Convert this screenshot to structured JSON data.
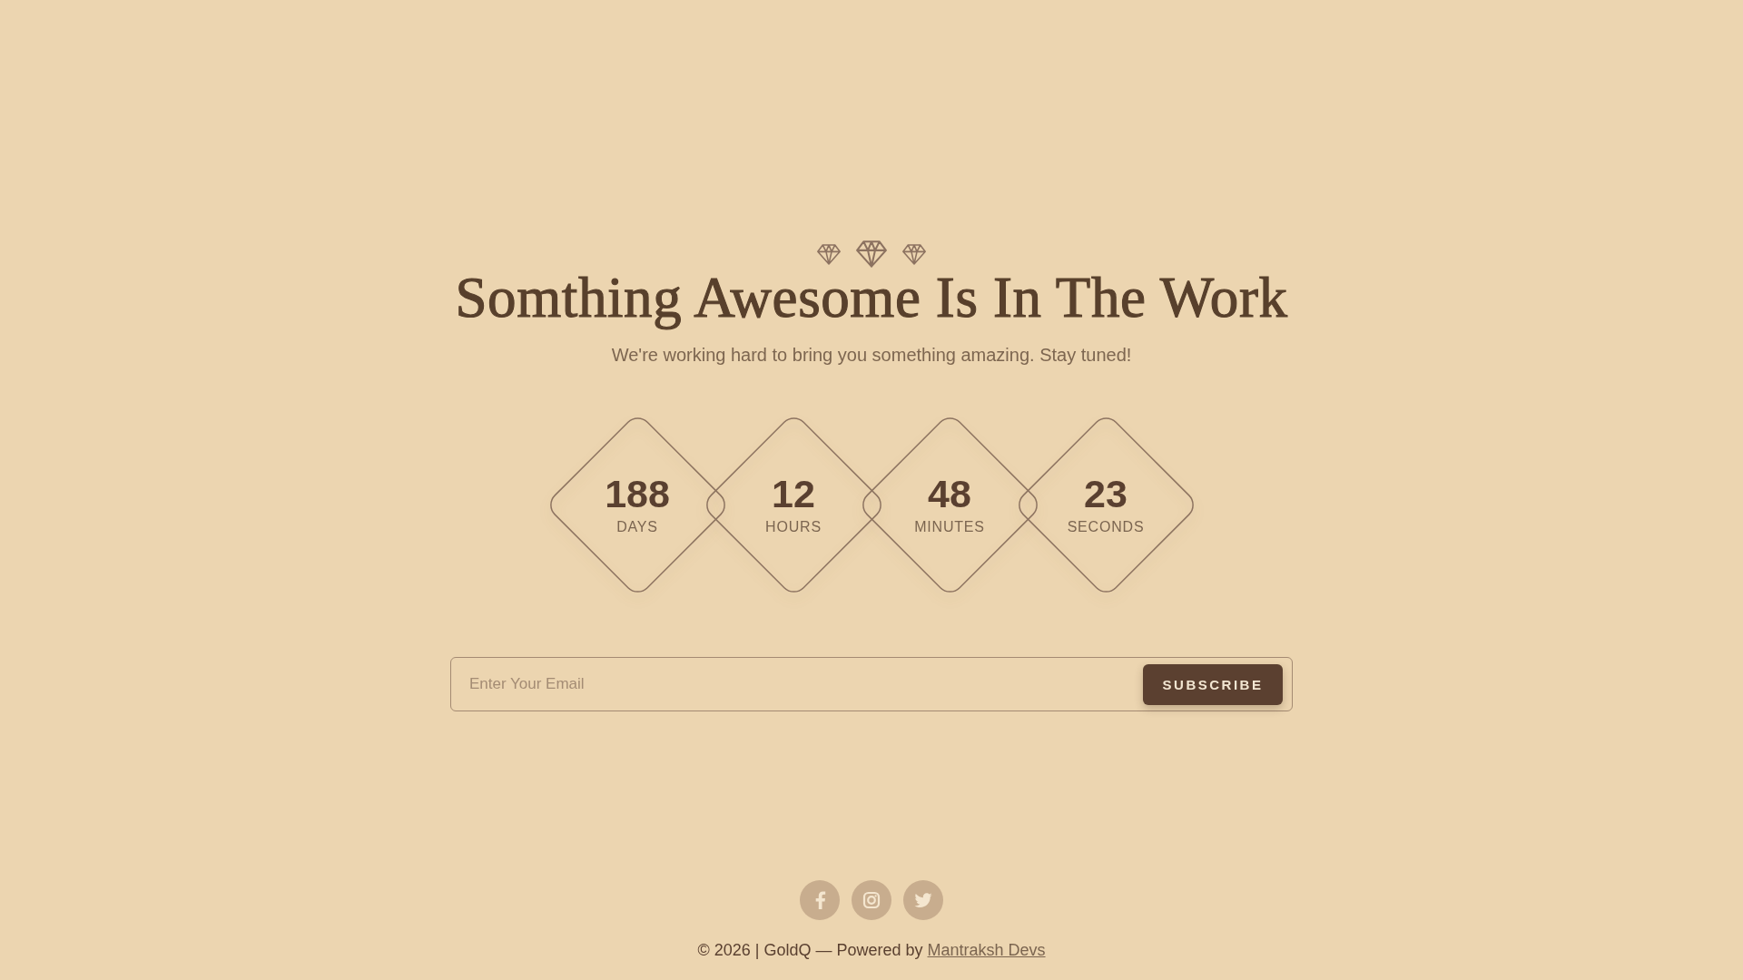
{
  "header": {
    "title": "Somthing Awesome Is In The Work",
    "subtitle": "We're working hard to bring you something amazing. Stay tuned!"
  },
  "countdown": [
    {
      "value": "188",
      "unit": "DAYS"
    },
    {
      "value": "12",
      "unit": "HOURS"
    },
    {
      "value": "48",
      "unit": "MINUTES"
    },
    {
      "value": "23",
      "unit": "SECONDS"
    }
  ],
  "subscribe": {
    "placeholder": "Enter Your Email",
    "button": "SUBSCRIBE"
  },
  "social_links": [
    {
      "kind": "facebook"
    },
    {
      "kind": "instagram"
    },
    {
      "kind": "twitter"
    }
  ],
  "footer": {
    "text": "© 2026 | GoldQ — Powered by",
    "link": "Mantraksh Devs"
  }
}
